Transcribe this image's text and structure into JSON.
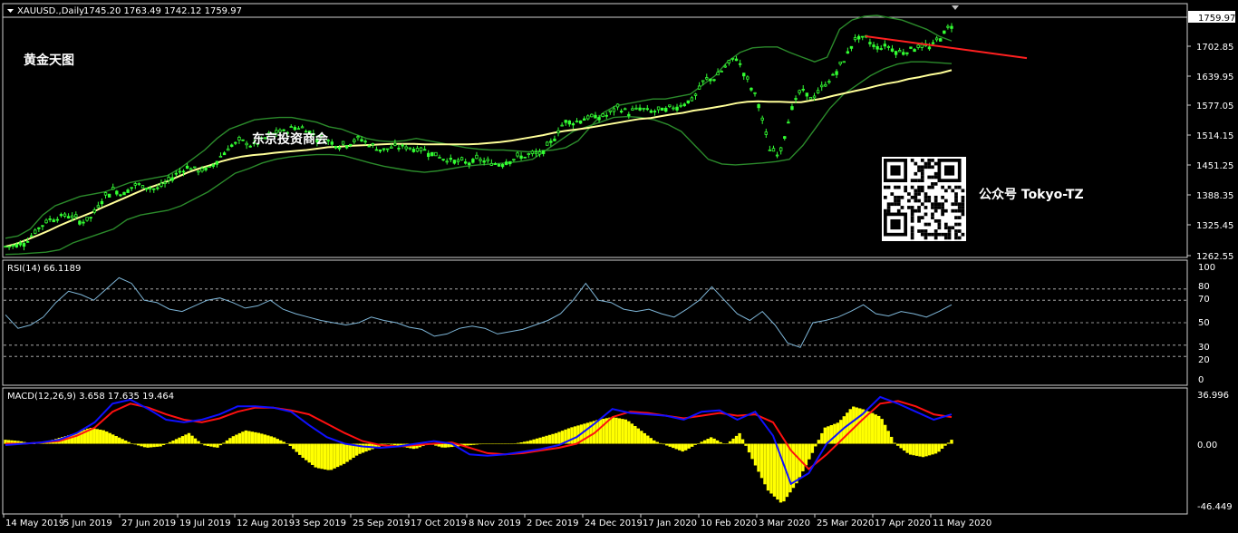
{
  "header": {
    "symbol": "XAUUSD.,Daily",
    "ohlc": "1745.20 1763.49 1742.12 1759.97"
  },
  "overlays": {
    "brand_text": "黄金天图",
    "center_text": "东京投资商会",
    "wechat_text": "公众号 Tokyo-TZ"
  },
  "colors": {
    "background": "#000000",
    "candle": "#33ff33",
    "bollinger": "#2b8a2b",
    "ma": "#ffff99",
    "trendline": "#ff2020",
    "rsi_line": "#7fb7d9",
    "macd_hist": "#ffff00",
    "macd_line": "#1010ff",
    "signal_line": "#ff1010"
  },
  "chart_data": [
    {
      "type": "candlestick",
      "title": "XAUUSD.,Daily",
      "ohlc_last": {
        "open": 1745.2,
        "high": 1763.49,
        "low": 1742.12,
        "close": 1759.97
      },
      "y_ticks": [
        "1759.97",
        "1702.85",
        "1639.95",
        "1577.05",
        "1514.15",
        "1451.25",
        "1388.35",
        "1325.45",
        "1262.55"
      ],
      "y_range": [
        1262.55,
        1776.0
      ],
      "x_ticks": [
        "14 May 2019",
        "5 Jun 2019",
        "27 Jun 2019",
        "19 Jul 2019",
        "12 Aug 2019",
        "3 Sep 2019",
        "25 Sep 2019",
        "17 Oct 2019",
        "8 Nov 2019",
        "2 Dec 2019",
        "24 Dec 2019",
        "17 Jan 2020",
        "10 Feb 2020",
        "3 Mar 2020",
        "25 Mar 2020",
        "17 Apr 2020",
        "11 May 2020"
      ],
      "close_series": [
        1282,
        1285,
        1295,
        1320,
        1340,
        1346,
        1350,
        1335,
        1345,
        1385,
        1405,
        1395,
        1415,
        1412,
        1405,
        1420,
        1441,
        1455,
        1445,
        1450,
        1476,
        1500,
        1510,
        1498,
        1513,
        1527,
        1530,
        1540,
        1535,
        1517,
        1510,
        1500,
        1505,
        1515,
        1500,
        1490,
        1495,
        1497,
        1493,
        1490,
        1480,
        1470,
        1465,
        1462,
        1470,
        1462,
        1460,
        1470,
        1476,
        1480,
        1483,
        1515,
        1552,
        1550,
        1560,
        1560,
        1565,
        1582,
        1570,
        1580,
        1573,
        1575,
        1580,
        1590,
        1600,
        1640,
        1645,
        1670,
        1690,
        1640,
        1595,
        1494,
        1480,
        1572,
        1620,
        1600,
        1625,
        1650,
        1683,
        1730,
        1730,
        1710,
        1715,
        1700,
        1705,
        1715,
        1710,
        1735,
        1760
      ],
      "ma_series": [
        1282,
        1288,
        1297,
        1306,
        1316,
        1327,
        1337,
        1346,
        1355,
        1366,
        1376,
        1386,
        1396,
        1406,
        1414,
        1422,
        1432,
        1442,
        1450,
        1457,
        1465,
        1471,
        1476,
        1479,
        1481,
        1484,
        1486,
        1488,
        1490,
        1493,
        1496,
        1497,
        1499,
        1500,
        1501,
        1502,
        1503,
        1503,
        1503,
        1502,
        1502,
        1502,
        1502,
        1502,
        1503,
        1505,
        1507,
        1510,
        1514,
        1518,
        1522,
        1527,
        1531,
        1534,
        1537,
        1541,
        1545,
        1549,
        1553,
        1557,
        1559,
        1563,
        1567,
        1570,
        1575,
        1578,
        1582,
        1586,
        1591,
        1594,
        1595,
        1594,
        1594,
        1593,
        1593,
        1597,
        1601,
        1607,
        1612,
        1617,
        1622,
        1628,
        1633,
        1637,
        1643,
        1647,
        1652,
        1656,
        1662
      ],
      "bb_upper": [
        1300,
        1305,
        1320,
        1350,
        1370,
        1380,
        1390,
        1395,
        1400,
        1410,
        1420,
        1425,
        1430,
        1435,
        1450,
        1470,
        1490,
        1515,
        1535,
        1545,
        1555,
        1558,
        1560,
        1560,
        1555,
        1550,
        1540,
        1535,
        1525,
        1515,
        1510,
        1508,
        1510,
        1515,
        1510,
        1505,
        1500,
        1495,
        1492,
        1490,
        1490,
        1488,
        1486,
        1488,
        1490,
        1495,
        1510,
        1540,
        1570,
        1585,
        1590,
        1595,
        1600,
        1600,
        1605,
        1610,
        1630,
        1650,
        1680,
        1700,
        1710,
        1712,
        1712,
        1700,
        1690,
        1680,
        1690,
        1750,
        1770,
        1778,
        1780,
        1775,
        1770,
        1760,
        1750,
        1735,
        1725
      ],
      "bb_lower": [
        1265,
        1266,
        1268,
        1270,
        1275,
        1290,
        1300,
        1310,
        1320,
        1340,
        1350,
        1355,
        1360,
        1370,
        1385,
        1400,
        1420,
        1440,
        1450,
        1462,
        1470,
        1475,
        1478,
        1480,
        1480,
        1478,
        1470,
        1462,
        1455,
        1450,
        1445,
        1442,
        1445,
        1450,
        1455,
        1458,
        1460,
        1462,
        1465,
        1470,
        1490,
        1510,
        1530,
        1540,
        1550,
        1560,
        1562,
        1560,
        1555,
        1545,
        1530,
        1500,
        1470,
        1460,
        1458,
        1460,
        1462,
        1465,
        1470,
        1500,
        1540,
        1580,
        1610,
        1630,
        1650,
        1665,
        1675,
        1680,
        1680,
        1678,
        1676
      ],
      "trendline": {
        "start": [
          "25 Mar 2020",
          1735
        ],
        "end": [
          "after 11 May 2020",
          1688
        ]
      }
    },
    {
      "type": "line",
      "title": "RSI(14) 66.1189",
      "last_value": 66.1189,
      "y_ticks": [
        "100",
        "80",
        "70",
        "50",
        "30",
        "20",
        "0"
      ],
      "y_range": [
        0,
        100
      ],
      "levels": [
        80,
        70,
        50,
        30,
        20
      ],
      "values": [
        57,
        45,
        48,
        55,
        68,
        78,
        75,
        70,
        80,
        90,
        85,
        70,
        68,
        62,
        60,
        65,
        70,
        72,
        68,
        63,
        65,
        70,
        62,
        58,
        55,
        52,
        50,
        48,
        50,
        55,
        52,
        50,
        46,
        44,
        38,
        40,
        45,
        47,
        45,
        40,
        42,
        44,
        48,
        52,
        58,
        70,
        85,
        70,
        68,
        62,
        60,
        62,
        58,
        55,
        62,
        70,
        82,
        70,
        58,
        52,
        60,
        48,
        32,
        28,
        50,
        52,
        55,
        60,
        66,
        58,
        56,
        60,
        58,
        55,
        60,
        66
      ]
    },
    {
      "type": "bar+line",
      "title": "MACD(12,26,9) 3.658 17.635 19.464",
      "last_values": [
        3.658,
        17.635,
        19.464
      ],
      "y_ticks": [
        "36.996",
        "0.00",
        "-46.449"
      ],
      "y_range": [
        -46.449,
        36.996
      ],
      "histogram": [
        3,
        2,
        0,
        2,
        5,
        8,
        12,
        10,
        5,
        0,
        -3,
        -2,
        3,
        8,
        -1,
        -3,
        5,
        10,
        8,
        5,
        0,
        -10,
        -18,
        -20,
        -15,
        -8,
        -4,
        0,
        -2,
        -4,
        0,
        -3,
        -2,
        -1,
        0,
        0,
        0,
        2,
        5,
        8,
        12,
        15,
        18,
        20,
        18,
        10,
        2,
        -2,
        -6,
        0,
        5,
        -1,
        8,
        -14,
        -35,
        -45,
        -30,
        -10,
        12,
        16,
        28,
        25,
        20,
        0,
        -8,
        -10,
        -7,
        3
      ],
      "macd_line": [
        -1,
        0,
        1,
        3,
        8,
        16,
        30,
        33,
        26,
        18,
        16,
        18,
        22,
        28,
        28,
        27,
        24,
        14,
        5,
        0,
        -2,
        -3,
        -2,
        0,
        2,
        0,
        -8,
        -9,
        -8,
        -6,
        -4,
        -1,
        5,
        15,
        26,
        23,
        22,
        21,
        18,
        24,
        25,
        18,
        24,
        6,
        -30,
        -22,
        0,
        12,
        22,
        35,
        30,
        24,
        18,
        22
      ],
      "signal_line": [
        0,
        0,
        1,
        2,
        6,
        12,
        24,
        30,
        27,
        22,
        18,
        16,
        19,
        24,
        27,
        27,
        25,
        22,
        15,
        8,
        2,
        -1,
        -2,
        -1,
        0,
        1,
        -3,
        -7,
        -8,
        -7,
        -5,
        -3,
        0,
        8,
        20,
        24,
        23,
        21,
        19,
        21,
        23,
        21,
        22,
        16,
        -5,
        -19,
        -8,
        5,
        18,
        30,
        32,
        28,
        22,
        20
      ]
    }
  ]
}
